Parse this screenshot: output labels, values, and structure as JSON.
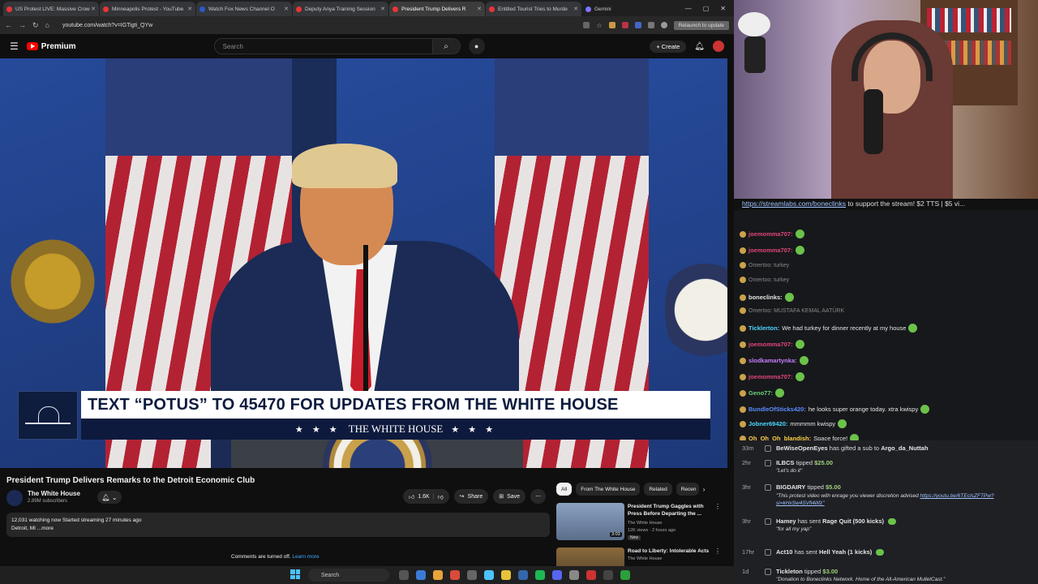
{
  "browser": {
    "tabs": [
      {
        "label": "US Protest LIVE: Massive Crow",
        "active": false
      },
      {
        "label": "Minneapolis Protest - YouTube",
        "active": false
      },
      {
        "label": "Watch Fox News Channel O",
        "active": false
      },
      {
        "label": "Deputy Anya Training Session",
        "active": false
      },
      {
        "label": "President Trump Delivers R",
        "active": true
      },
      {
        "label": "Entitled Tourist Tries to Murde",
        "active": false
      }
    ],
    "gemini_tab": "Gemini",
    "url": "youtube.com/watch?v=IGTigti_QYw",
    "relaunch_label": "Relaunch to update"
  },
  "youtube": {
    "logo_text": "Premium",
    "search_placeholder": "Search",
    "create_label": "Create",
    "lower_third": {
      "headline": "TEXT “POTUS” TO 45470 FOR UPDATES FROM THE WHITE HOUSE",
      "stars_left": "★ ★ ★",
      "brand": "THE WHITE HOUSE",
      "stars_right": "★ ★ ★"
    },
    "video_title": "President Trump Delivers Remarks to the Detroit Economic Club",
    "channel": {
      "name": "The White House",
      "subscribers": "2.89M subscribers"
    },
    "likes": "1.6K",
    "share_label": "Share",
    "save_label": "Save",
    "description": {
      "line1": "12,031 watching now  Started streaming 27 minutes ago",
      "line2": "Detroit, MI ...more"
    },
    "comments_off": "Comments are turned off.",
    "learn_more": "Learn more",
    "chips": [
      "All",
      "From The White House",
      "Related",
      "Recen"
    ],
    "recommendations": [
      {
        "title": "President Trump Gaggles with Press Before Departing the ...",
        "channel": "The White House",
        "meta": "12K views · 2 hours ago",
        "badge": "New",
        "duration": "3:03"
      },
      {
        "title": "Road to Liberty: Intolerable Acts",
        "channel": "The White House",
        "meta": "",
        "badge": "",
        "duration": ""
      }
    ]
  },
  "chat": {
    "pinned_link": "https://streamlabs.com/boneclinks",
    "pinned_text": " to support the stream! $2 TTS | $5 vi...",
    "messages": [
      {
        "user": "joemomma707:",
        "text": "",
        "color": "#e0457b",
        "reply": ""
      },
      {
        "user": "joemomma707:",
        "text": "",
        "color": "#e0457b",
        "reply": ""
      },
      {
        "user": "",
        "text": "",
        "color": "#888888",
        "reply": "Omertoo: turkey"
      },
      {
        "user": "",
        "text": "",
        "color": "#888888",
        "reply": "Omertoo: turkey"
      },
      {
        "user": "boneclinks:",
        "text": "",
        "color": "#e6e6e6",
        "reply": ""
      },
      {
        "user": "",
        "text": "",
        "color": "#888888",
        "reply": "Omertoo: MUSTAFA KEMAL AATÜRK"
      },
      {
        "user": "Ticklerton:",
        "text": "We had turkey for dinner recently at my house",
        "color": "#4ad8ff",
        "reply": ""
      },
      {
        "user": "joemomma707:",
        "text": "",
        "color": "#e0457b",
        "reply": ""
      },
      {
        "user": "slodkamartynka:",
        "text": "",
        "color": "#c77dff",
        "reply": ""
      },
      {
        "user": "joemomma707:",
        "text": "",
        "color": "#e0457b",
        "reply": ""
      },
      {
        "user": "Geno77:",
        "text": "",
        "color": "#6bd37b",
        "reply": ""
      },
      {
        "user": "BundleOfSticks420:",
        "text": "he looks super orange today. xtra kwispy",
        "color": "#5a8cff",
        "reply": ""
      },
      {
        "user": "Jobner69420:",
        "text": "mmmmm kwispy",
        "color": "#4ad8ff",
        "reply": ""
      },
      {
        "user": "Oh_Oh_Oh_blandish:",
        "text": "Space force!",
        "color": "#ffd24a",
        "reply": ""
      }
    ]
  },
  "events": [
    {
      "time": "33m",
      "line1_user": "BeWiseOpenEyes",
      "line1_mid": " has gifted a sub to ",
      "line1_target": "Argo_da_Nuttah",
      "amount": "",
      "note": "",
      "note_link": ""
    },
    {
      "time": "2hr",
      "line1_user": "ILBCS",
      "line1_mid": " tipped ",
      "line1_target": "",
      "amount": "$25.00",
      "note": "\"Let's do it\"",
      "note_link": ""
    },
    {
      "time": "3hr",
      "line1_user": "BIGDAIRY",
      "line1_mid": " tipped ",
      "line1_target": "",
      "amount": "$5.00",
      "note": "\"This protest video with enrage you viewer discretion advised ",
      "note_link": "https://youtu.be/6TEcIsZFTPw?si=kHxSw4SVfi4ilifz\""
    },
    {
      "time": "3hr",
      "line1_user": "Hamey",
      "line1_mid": " has sent ",
      "line1_target": "Rage Quit (500 kicks)",
      "amount": "",
      "note": "\"for all my yap\"",
      "note_link": ""
    },
    {
      "time": "17hr",
      "line1_user": "Act10",
      "line1_mid": " has sent ",
      "line1_target": "Hell Yeah (1 kicks)",
      "amount": "",
      "note": "",
      "note_link": ""
    },
    {
      "time": "1d",
      "line1_user": "Tickleton",
      "line1_mid": " tipped ",
      "line1_target": "",
      "amount": "$3.00",
      "note": "\"Donation to Boneclinks Network. Home of the All-American MulletCast.\"",
      "note_link": ""
    }
  ],
  "taskbar": {
    "search_label": "Search"
  }
}
